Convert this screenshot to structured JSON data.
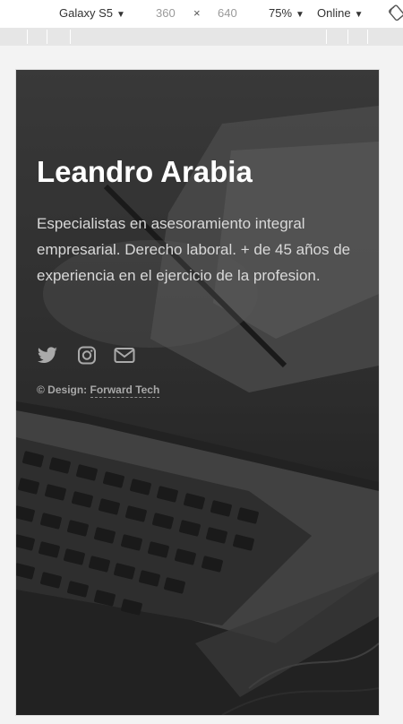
{
  "devtools": {
    "device": "Galaxy S5",
    "width": "360",
    "times": "×",
    "height": "640",
    "zoom": "75%",
    "network": "Online",
    "caret": "▼"
  },
  "page": {
    "title": "Leandro Arabia",
    "description": "Especialistas en asesoramiento integral empresarial. Derecho laboral. + de 45 años de experiencia en el ejercicio de la profesion.",
    "credit_prefix": "© Design: ",
    "credit_link": "Forward Tech",
    "social": [
      "twitter-icon",
      "instagram-icon",
      "mail-icon"
    ]
  }
}
